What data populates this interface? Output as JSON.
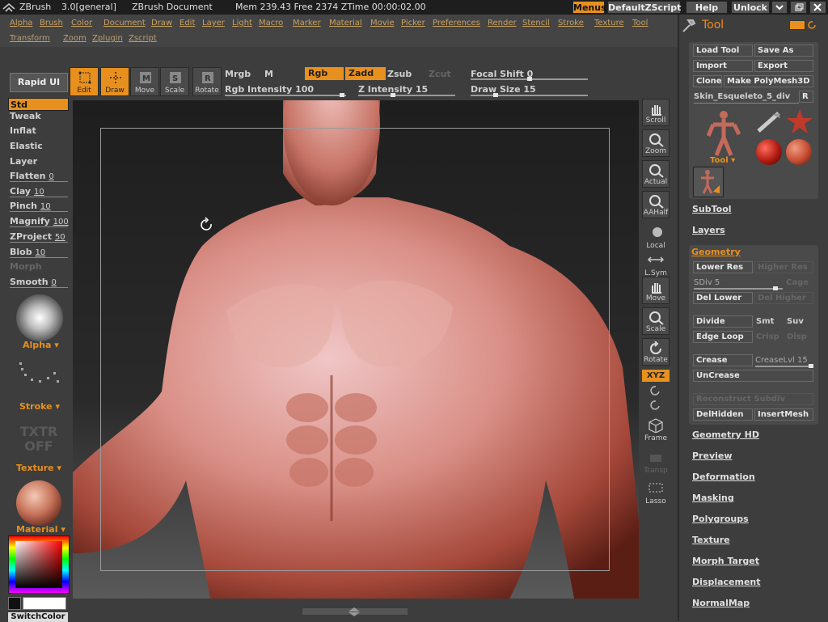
{
  "titlebar": {
    "app": "ZBrush",
    "version": "3.0[general]",
    "document": "ZBrush Document",
    "mem": "Mem 239.43 Free 2374 ZTime 00:00:02.00",
    "buttons": {
      "menus": "Menus",
      "script": "DefaultZScript",
      "help": "Help",
      "unlock": "Unlock"
    }
  },
  "menus_row1": [
    "Alpha",
    "Brush",
    "Color",
    "Document",
    "Draw",
    "Edit",
    "Layer",
    "Light",
    "Macro",
    "Marker",
    "Material",
    "Movie",
    "Picker",
    "Preferences",
    "Render",
    "Stencil",
    "Stroke",
    "Texture",
    "Tool"
  ],
  "menus_row2": [
    "Transform",
    "Zoom",
    "Zplugin",
    "Zscript"
  ],
  "toolbar": {
    "rapid_ui": "Rapid UI",
    "edit": "Edit",
    "draw": "Draw",
    "move": "Move",
    "scale": "Scale",
    "rotate": "Rotate",
    "mrgb": "Mrgb",
    "m": "M",
    "rgb": "Rgb",
    "zadd": "Zadd",
    "zsub": "Zsub",
    "zcut": "Zcut",
    "rgb_intensity": "Rgb Intensity 100",
    "z_intensity": "Z Intensity 15",
    "focal_shift": "Focal Shift 0",
    "draw_size": "Draw Size 15",
    "rgb_intensity_value": 100,
    "z_intensity_value": 15,
    "focal_shift_value": 0,
    "draw_size_value": 15
  },
  "brushes": {
    "std": "Std",
    "tweak": "Tweak",
    "inflat": "Inflat",
    "elastic": "Elastic",
    "layer": "Layer",
    "flatten": "Flatten",
    "flatten_val": "0",
    "clay": "Clay",
    "clay_val": "10",
    "pinch": "Pinch",
    "pinch_val": "10",
    "magnify": "Magnify",
    "magnify_val": "100",
    "zproject": "ZProject",
    "zproject_val": "50",
    "blob": "Blob",
    "blob_val": "10",
    "morph": "Morph",
    "smooth": "Smooth",
    "smooth_val": "0"
  },
  "leftpanel": {
    "alpha": "Alpha",
    "stroke": "Stroke",
    "texture_off": "TXTR OFF",
    "texture": "Texture",
    "material": "Material",
    "switch_color": "SwitchColor"
  },
  "canvas_tools": {
    "scroll": "Scroll",
    "zoom": "Zoom",
    "actual": "Actual",
    "aahalf": "AAHalf",
    "local": "Local",
    "lsym": "L.Sym",
    "move": "Move",
    "scale": "Scale",
    "rotate": "Rotate",
    "xyz": "XYZ",
    "frame": "Frame",
    "transp": "Transp",
    "lasso": "Lasso"
  },
  "tool": {
    "title": "Tool",
    "load_tool": "Load Tool",
    "save_as": "Save As",
    "import": "Import",
    "export": "Export",
    "clone": "Clone",
    "make_polymesh": "Make PolyMesh3D",
    "current_tool": "Skin_Esqueleto_5_div",
    "r": "R",
    "tool_label": "Tool",
    "subtool": "SubTool",
    "layers": "Layers",
    "geometry": "Geometry",
    "lower_res": "Lower Res",
    "higher_res": "Higher Res",
    "sdiv": "SDiv 5",
    "sdiv_value": 5,
    "cage": "Cage",
    "del_lower": "Del Lower",
    "del_higher": "Del Higher",
    "divide": "Divide",
    "smt": "Smt",
    "suv": "Suv",
    "edge_loop": "Edge Loop",
    "crisp": "Crisp",
    "disp": "Disp",
    "crease": "Crease",
    "creaselvl": "CreaseLvl 15",
    "uncrease": "UnCrease",
    "reconstruct": "Reconstruct Subdiv",
    "delhidden": "DelHidden",
    "insertmesh": "InsertMesh",
    "sections": [
      "Geometry HD",
      "Preview",
      "Deformation",
      "Masking",
      "Polygroups",
      "Texture",
      "Morph Target",
      "Displacement",
      "NormalMap"
    ]
  },
  "colors": {
    "accent": "#e8901d",
    "panel": "#3d3d3d",
    "button": "#4a4a4a"
  }
}
